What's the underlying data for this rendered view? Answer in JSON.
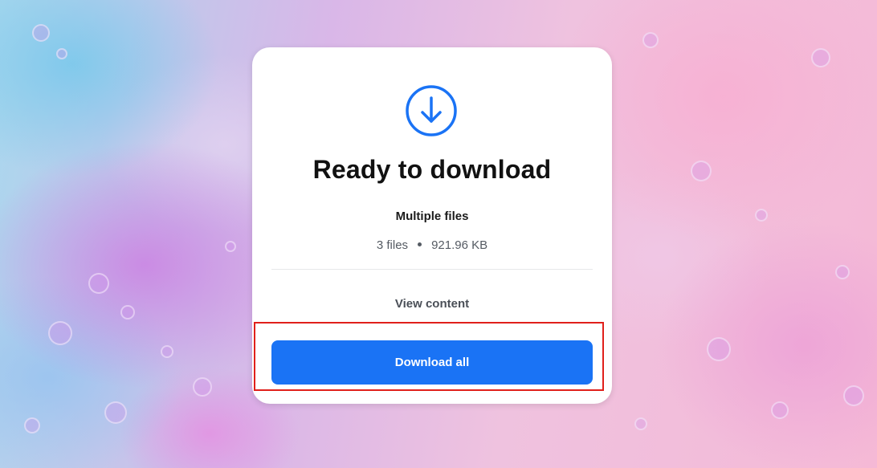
{
  "card": {
    "icon": "download-circle-icon",
    "title": "Ready to download",
    "subtitle": "Multiple files",
    "file_count": "3 files",
    "file_size": "921.96 KB",
    "view_content_label": "View content",
    "download_all_label": "Download all"
  },
  "colors": {
    "accent": "#1a73f5",
    "highlight_border": "#e0201b"
  }
}
